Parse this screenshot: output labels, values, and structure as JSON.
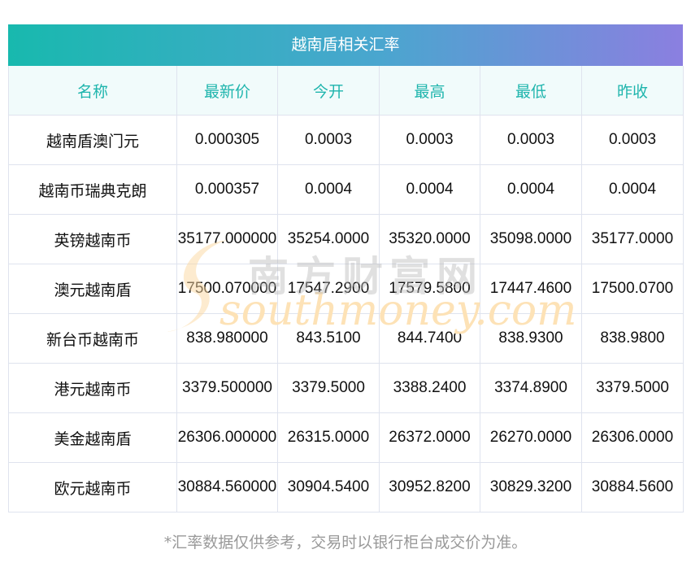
{
  "title": "越南盾相关汇率",
  "columns": [
    "名称",
    "最新价",
    "今开",
    "最高",
    "最低",
    "昨收"
  ],
  "rows": [
    [
      "越南盾澳门元",
      "0.000305",
      "0.0003",
      "0.0003",
      "0.0003",
      "0.0003"
    ],
    [
      "越南币瑞典克朗",
      "0.000357",
      "0.0004",
      "0.0004",
      "0.0004",
      "0.0004"
    ],
    [
      "英镑越南币",
      "35177.000000",
      "35254.0000",
      "35320.0000",
      "35098.0000",
      "35177.0000"
    ],
    [
      "澳元越南盾",
      "17500.070000",
      "17547.2900",
      "17579.5800",
      "17447.4600",
      "17500.0700"
    ],
    [
      "新台币越南币",
      "838.980000",
      "843.5100",
      "844.7400",
      "838.9300",
      "838.9800"
    ],
    [
      "港元越南币",
      "3379.500000",
      "3379.5000",
      "3388.2400",
      "3374.8900",
      "3379.5000"
    ],
    [
      "美金越南盾",
      "26306.000000",
      "26315.0000",
      "26372.0000",
      "26270.0000",
      "26306.0000"
    ],
    [
      "欧元越南币",
      "30884.560000",
      "30904.5400",
      "30952.8200",
      "30829.3200",
      "30884.5600"
    ]
  ],
  "watermark": {
    "cn": "南方财富网",
    "en": "southmoney.com"
  },
  "footnote": "*汇率数据仅供参考，交易时以银行柜台成交价为准。"
}
